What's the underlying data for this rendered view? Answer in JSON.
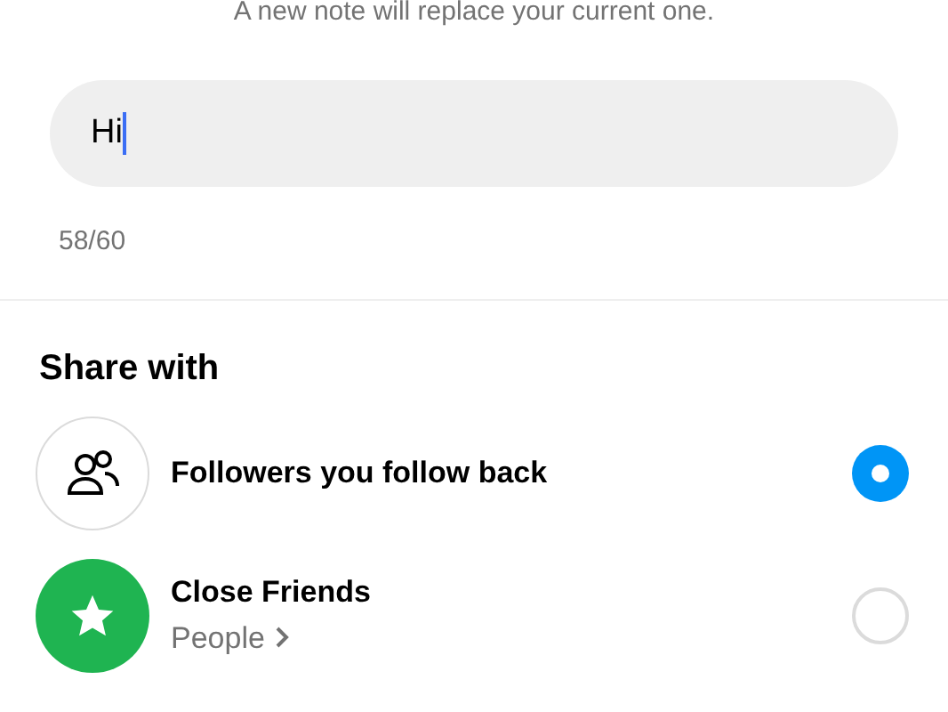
{
  "subtitle": "A new note will replace your current one.",
  "note": {
    "value": "Hi",
    "counter": "58/60"
  },
  "share": {
    "title": "Share with",
    "options": [
      {
        "kind": "followers",
        "label": "Followers you follow back",
        "selected": true
      },
      {
        "kind": "close_friends",
        "label": "Close Friends",
        "sublabel": "People",
        "selected": false
      }
    ]
  }
}
